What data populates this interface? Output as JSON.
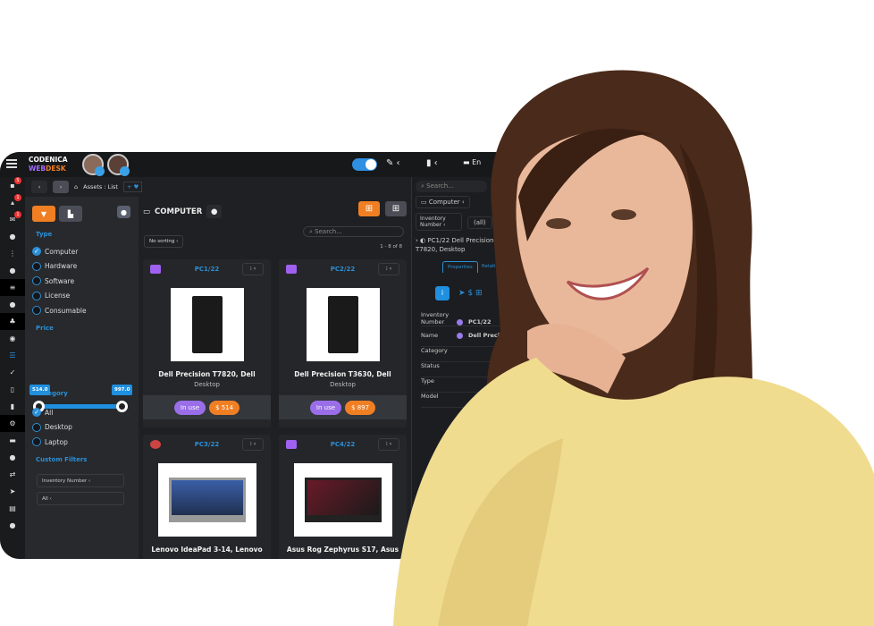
{
  "brand": {
    "line1": "CODENICA",
    "line2a": "WEB",
    "line2b": "DESK"
  },
  "topbar": {
    "language": "En"
  },
  "rail": {
    "badges": [
      "5",
      "1",
      "1"
    ]
  },
  "breadcrumb": {
    "path": "Assets : List",
    "add": "+ ♥"
  },
  "filters": {
    "type_label": "Type",
    "types": [
      {
        "label": "Computer",
        "checked": true
      },
      {
        "label": "Hardware",
        "checked": false
      },
      {
        "label": "Software",
        "checked": false
      },
      {
        "label": "License",
        "checked": false
      },
      {
        "label": "Consumable",
        "checked": false
      }
    ],
    "price_label": "Price",
    "price_min": "514.0",
    "price_max": "997.0",
    "category_label": "Category",
    "categories": [
      {
        "label": "All",
        "checked": true
      },
      {
        "label": "Desktop",
        "checked": false
      },
      {
        "label": "Laptop",
        "checked": false
      }
    ],
    "custom_label": "Custom Filters",
    "custom": [
      "Inventory Number",
      "All"
    ]
  },
  "main": {
    "title": "COMPUTER",
    "sorting": "No sorting",
    "search_placeholder": "Search...",
    "count": "1 - 8 of 8",
    "cards": [
      {
        "id": "PC1/22",
        "name": "Dell Precision T7820, Dell",
        "sub": "Desktop",
        "status": "In use",
        "price": "$ 514"
      },
      {
        "id": "PC2/22",
        "name": "Dell Precision T3630, Dell",
        "sub": "Desktop",
        "status": "In use",
        "price": "$ 897"
      },
      {
        "id": "PC3/22",
        "name": "Lenovo IdeaPad 3-14, Lenovo"
      },
      {
        "id": "PC4/22",
        "name": "Asus Rog Zephyrus S17, Asus"
      }
    ]
  },
  "detail": {
    "search_placeholder": "Search...",
    "type": "Computer",
    "filter_field": "Inventory Number",
    "filter_value": "(all)",
    "item": "PC1/22 Dell Precision T7820, Desktop",
    "tabs": [
      "Properties",
      "Relations"
    ],
    "rows": [
      {
        "label": "Inventory Number",
        "value": "PC1/22"
      },
      {
        "label": "Name",
        "value": "Dell Precision T7820"
      },
      {
        "label": "Category",
        "value": ""
      },
      {
        "label": "Status",
        "value": ""
      },
      {
        "label": "Type",
        "value": ""
      },
      {
        "label": "Model",
        "value": ""
      }
    ]
  },
  "colors": {
    "accent": "#2b8fd6",
    "orange": "#f07f24",
    "purple": "#9a6ee8",
    "bg": "#1f2023"
  }
}
